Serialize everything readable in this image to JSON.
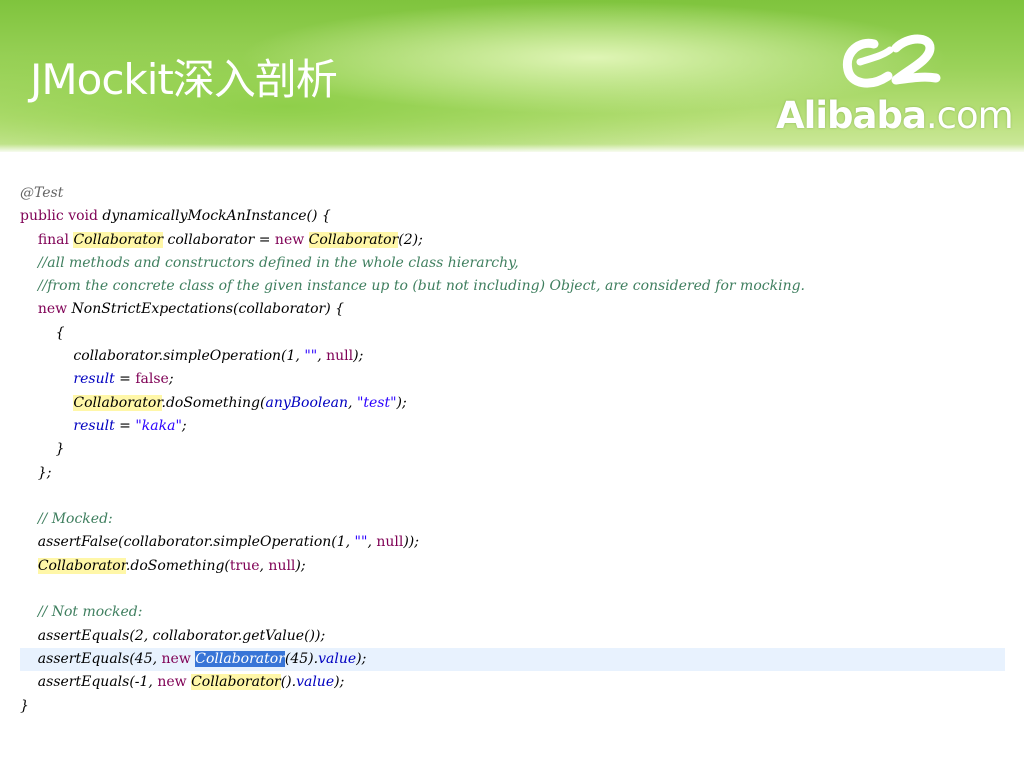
{
  "slide": {
    "title": "JMockit深入剖析",
    "logo_text": "Alibaba",
    "logo_suffix": ".com",
    "logo_icon": "alibaba-swirl-logo-icon"
  },
  "colors": {
    "banner_green": "#8cc84b",
    "keyword": "#7f0055",
    "comment": "#3f7f5f",
    "string": "#2a00ff",
    "field": "#0000c0",
    "occurrence_highlight": "#fff7a8",
    "selection": "#3875d7",
    "current_line": "#e8f2fe"
  },
  "code": [
    {
      "segments": [
        {
          "t": "@Test",
          "c": "ann"
        }
      ]
    },
    {
      "segments": [
        {
          "t": "public",
          "c": "kw"
        },
        {
          "t": " "
        },
        {
          "t": "void",
          "c": "kw"
        },
        {
          "t": " dynamicallyMockAnInstance() {"
        }
      ]
    },
    {
      "segments": [
        {
          "t": "    "
        },
        {
          "t": "final",
          "c": "kw"
        },
        {
          "t": " "
        },
        {
          "t": "Collaborator",
          "c": "hl"
        },
        {
          "t": " collaborator = "
        },
        {
          "t": "new",
          "c": "kw"
        },
        {
          "t": " "
        },
        {
          "t": "Collaborator",
          "c": "hl"
        },
        {
          "t": "(2);"
        }
      ]
    },
    {
      "segments": [
        {
          "t": "    "
        },
        {
          "t": "//all methods and constructors defined in the whole class hierarchy,",
          "c": "cm"
        }
      ]
    },
    {
      "segments": [
        {
          "t": "    "
        },
        {
          "t": "//from the concrete class of the given instance up to (but not including) Object, are considered for mocking.",
          "c": "cm"
        }
      ]
    },
    {
      "segments": [
        {
          "t": "    "
        },
        {
          "t": "new",
          "c": "kw"
        },
        {
          "t": " NonStrictExpectations(collaborator) {"
        }
      ]
    },
    {
      "segments": [
        {
          "t": "        {"
        }
      ]
    },
    {
      "segments": [
        {
          "t": "            collaborator.simpleOperation(1, "
        },
        {
          "t": "\"\"",
          "c": "st"
        },
        {
          "t": ", "
        },
        {
          "t": "null",
          "c": "kw"
        },
        {
          "t": ");"
        }
      ]
    },
    {
      "segments": [
        {
          "t": "            "
        },
        {
          "t": "result",
          "c": "fld"
        },
        {
          "t": " = "
        },
        {
          "t": "false",
          "c": "kw"
        },
        {
          "t": ";"
        }
      ]
    },
    {
      "segments": [
        {
          "t": "            "
        },
        {
          "t": "Collaborator",
          "c": "hl"
        },
        {
          "t": ".doSomething("
        },
        {
          "t": "anyBoolean",
          "c": "fld"
        },
        {
          "t": ", "
        },
        {
          "t": "\"test\"",
          "c": "st"
        },
        {
          "t": ");"
        }
      ]
    },
    {
      "segments": [
        {
          "t": "            "
        },
        {
          "t": "result",
          "c": "fld"
        },
        {
          "t": " = "
        },
        {
          "t": "\"kaka\"",
          "c": "st"
        },
        {
          "t": ";"
        }
      ]
    },
    {
      "segments": [
        {
          "t": "        }"
        }
      ]
    },
    {
      "segments": [
        {
          "t": "    };"
        }
      ]
    },
    {
      "segments": [
        {
          "t": ""
        }
      ]
    },
    {
      "segments": [
        {
          "t": "    "
        },
        {
          "t": "// Mocked:",
          "c": "cm"
        }
      ]
    },
    {
      "segments": [
        {
          "t": "    assertFalse(collaborator.simpleOperation(1, "
        },
        {
          "t": "\"\"",
          "c": "st"
        },
        {
          "t": ", "
        },
        {
          "t": "null",
          "c": "kw"
        },
        {
          "t": "));"
        }
      ]
    },
    {
      "segments": [
        {
          "t": "    "
        },
        {
          "t": "Collaborator",
          "c": "hl"
        },
        {
          "t": ".doSomething("
        },
        {
          "t": "true",
          "c": "kw"
        },
        {
          "t": ", "
        },
        {
          "t": "null",
          "c": "kw"
        },
        {
          "t": ");"
        }
      ]
    },
    {
      "segments": [
        {
          "t": ""
        }
      ]
    },
    {
      "segments": [
        {
          "t": "    "
        },
        {
          "t": "// Not mocked:",
          "c": "cm"
        }
      ]
    },
    {
      "segments": [
        {
          "t": "    assertEquals(2, collaborator.getValue());"
        }
      ]
    },
    {
      "current": true,
      "segments": [
        {
          "t": "    assertEquals(45, "
        },
        {
          "t": "new",
          "c": "kw"
        },
        {
          "t": " "
        },
        {
          "t": "Collaborator",
          "c": "sel"
        },
        {
          "t": "(45)."
        },
        {
          "t": "value",
          "c": "fld"
        },
        {
          "t": ");"
        }
      ]
    },
    {
      "segments": [
        {
          "t": "    assertEquals(-1, "
        },
        {
          "t": "new",
          "c": "kw"
        },
        {
          "t": " "
        },
        {
          "t": "Collaborator",
          "c": "hl"
        },
        {
          "t": "()."
        },
        {
          "t": "value",
          "c": "fld"
        },
        {
          "t": ");"
        }
      ]
    },
    {
      "segments": [
        {
          "t": "}"
        }
      ]
    }
  ]
}
